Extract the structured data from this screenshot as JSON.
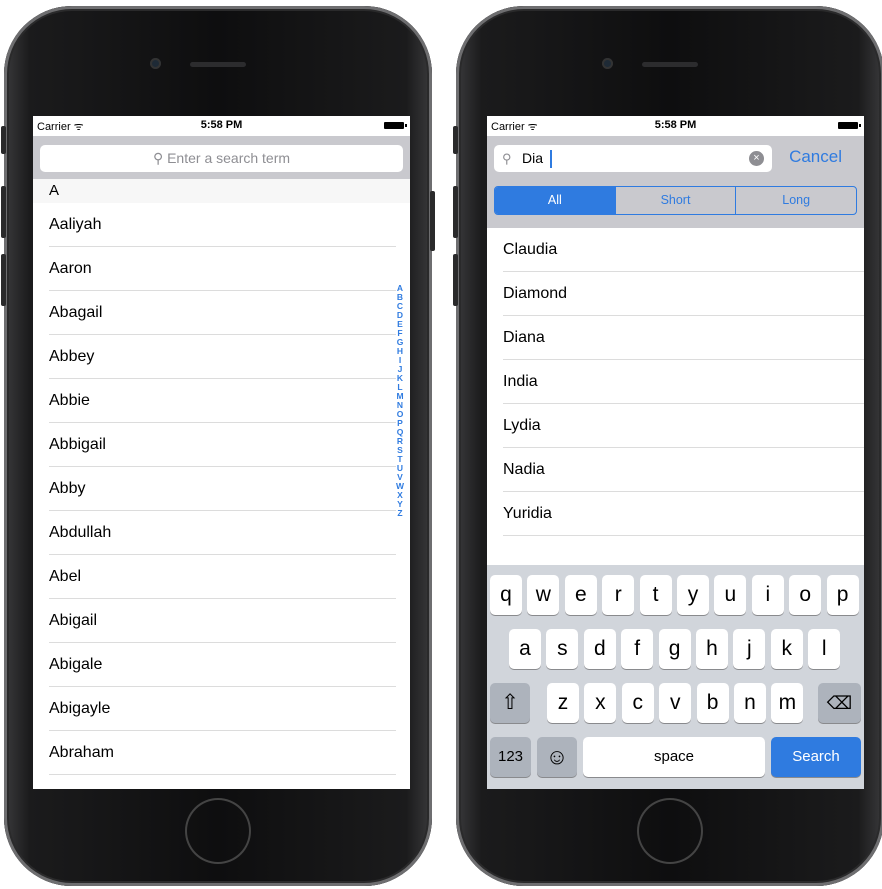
{
  "status_bar": {
    "carrier": "Carrier ᯤ",
    "time": "5:58 PM"
  },
  "left_screen": {
    "search_placeholder": "⚲  Enter a search term",
    "section_header": "A",
    "rows": [
      "Aaliyah",
      "Aaron",
      "Abagail",
      "Abbey",
      "Abbie",
      "Abbigail",
      "Abby",
      "Abdullah",
      "Abel",
      "Abigail",
      "Abigale",
      "Abigayle",
      "Abraham"
    ],
    "index_letters": [
      "A",
      "B",
      "C",
      "D",
      "E",
      "F",
      "G",
      "H",
      "I",
      "J",
      "K",
      "L",
      "M",
      "N",
      "O",
      "P",
      "Q",
      "R",
      "S",
      "T",
      "U",
      "V",
      "W",
      "X",
      "Y",
      "Z"
    ]
  },
  "right_screen": {
    "search_icon": "⚲",
    "search_value": "Dia",
    "clear_icon": "×",
    "cancel_label": "Cancel",
    "scope": [
      "All",
      "Short",
      "Long"
    ],
    "selected_scope": "All",
    "results": [
      "Claudia",
      "Diamond",
      "Diana",
      "India",
      "Lydia",
      "Nadia",
      "Yuridia"
    ],
    "keyboard": {
      "row1": [
        "q",
        "w",
        "e",
        "r",
        "t",
        "y",
        "u",
        "i",
        "o",
        "p"
      ],
      "row2": [
        "a",
        "s",
        "d",
        "f",
        "g",
        "h",
        "j",
        "k",
        "l"
      ],
      "row3": [
        "z",
        "x",
        "c",
        "v",
        "b",
        "n",
        "m"
      ],
      "shift_icon": "⇧",
      "delete_icon": "⌫",
      "numbers_label": "123",
      "emoji_icon": "☺",
      "space_label": "space",
      "search_label": "Search"
    }
  },
  "colors": {
    "accent": "#2f7be0",
    "search_bar_bg": "#c9c9ce",
    "keyboard_bg": "#d1d5db"
  }
}
